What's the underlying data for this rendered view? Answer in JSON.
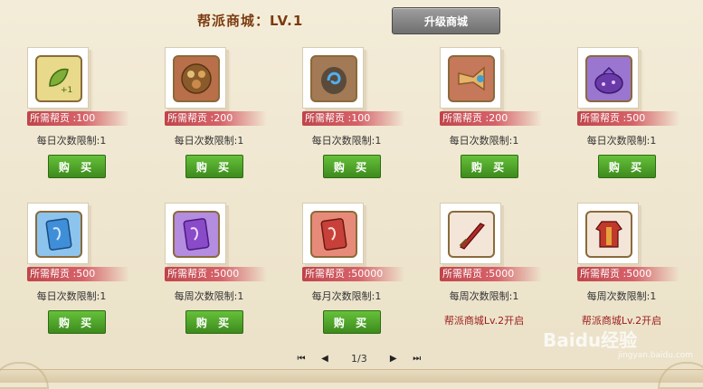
{
  "header": {
    "title": "帮派商城：LV.1",
    "upgrade_label": "升级商城"
  },
  "items": [
    {
      "price": "所需帮贡 :100",
      "limit": "每日次数限制:1",
      "buy": "购 买",
      "locked": "",
      "icon": "green-leaf-icon",
      "color": "#7fae39",
      "bg": "#e9d98a"
    },
    {
      "price": "所需帮贡 :200",
      "limit": "每日次数限制:1",
      "buy": "购 买",
      "locked": "",
      "icon": "food-platter-icon",
      "color": "#8b5a2b",
      "bg": "#b86f4a"
    },
    {
      "price": "所需帮贡 :100",
      "limit": "每日次数限制:1",
      "buy": "购 买",
      "locked": "",
      "icon": "blue-stone-icon",
      "color": "#3b7fc8",
      "bg": "#a27a55"
    },
    {
      "price": "所需帮贡 :200",
      "limit": "每日次数限制:1",
      "buy": "购 买",
      "locked": "",
      "icon": "horn-icon",
      "color": "#d8a05a",
      "bg": "#c5785a"
    },
    {
      "price": "所需帮贡 :500",
      "limit": "每日次数限制:1",
      "buy": "购 买",
      "locked": "",
      "icon": "purple-bag-icon",
      "color": "#7a4bc0",
      "bg": "#9b76d0"
    },
    {
      "price": "所需帮贡 :500",
      "limit": "每日次数限制:1",
      "buy": "购 买",
      "locked": "",
      "icon": "blue-talisman-icon",
      "color": "#3f8fd8",
      "bg": "#8cc4ee"
    },
    {
      "price": "所需帮贡 :5000",
      "limit": "每周次数限制:1",
      "buy": "购 买",
      "locked": "",
      "icon": "purple-talisman-icon",
      "color": "#8a4bc8",
      "bg": "#b48ce0"
    },
    {
      "price": "所需帮贡 :50000",
      "limit": "每月次数限制:1",
      "buy": "购 买",
      "locked": "",
      "icon": "red-talisman-icon",
      "color": "#c8403a",
      "bg": "#e88a7a"
    },
    {
      "price": "所需帮贡 :5000",
      "limit": "每周次数限制:1",
      "buy": "",
      "locked": "帮派商城Lv.2开启",
      "icon": "red-sword-icon",
      "color": "#b02a2a",
      "bg": "#f3e6d8"
    },
    {
      "price": "所需帮贡 :5000",
      "limit": "每周次数限制:1",
      "buy": "",
      "locked": "帮派商城Lv.2开启",
      "icon": "red-armor-icon",
      "color": "#c0392b",
      "bg": "#f3e6d8"
    }
  ],
  "pager": {
    "page": "1/3",
    "first": "⏮",
    "prev": "◀",
    "next": "▶",
    "last": "⏭"
  },
  "watermark": {
    "text": "Baidu经验",
    "url": "jingyan.baidu.com"
  }
}
